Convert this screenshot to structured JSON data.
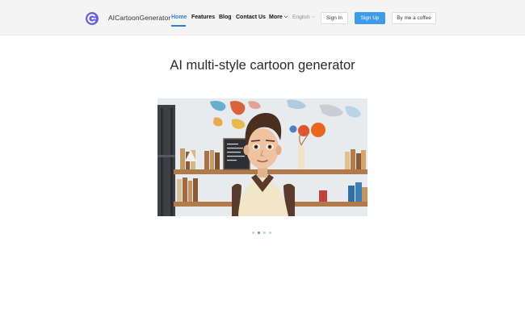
{
  "header": {
    "brand": "AICartoonGenerator",
    "nav": [
      {
        "label": "Home",
        "active": true
      },
      {
        "label": "Features"
      },
      {
        "label": "Blog"
      },
      {
        "label": "Contact Us"
      },
      {
        "label": "More"
      }
    ],
    "language": "English",
    "sign_in": "Sign In",
    "sign_up": "Sign Up",
    "coffee": "By me a coffee"
  },
  "main": {
    "title": "AI multi-style cartoon generator",
    "carousel": {
      "slides": 4,
      "active_index": 1
    }
  },
  "colors": {
    "accent": "#3e9be9",
    "logo": "#6c63d9"
  },
  "icons": {
    "logo": "cartoon-generator-logo-icon",
    "more": "chevron-down-icon",
    "language": "chevron-down-icon"
  }
}
